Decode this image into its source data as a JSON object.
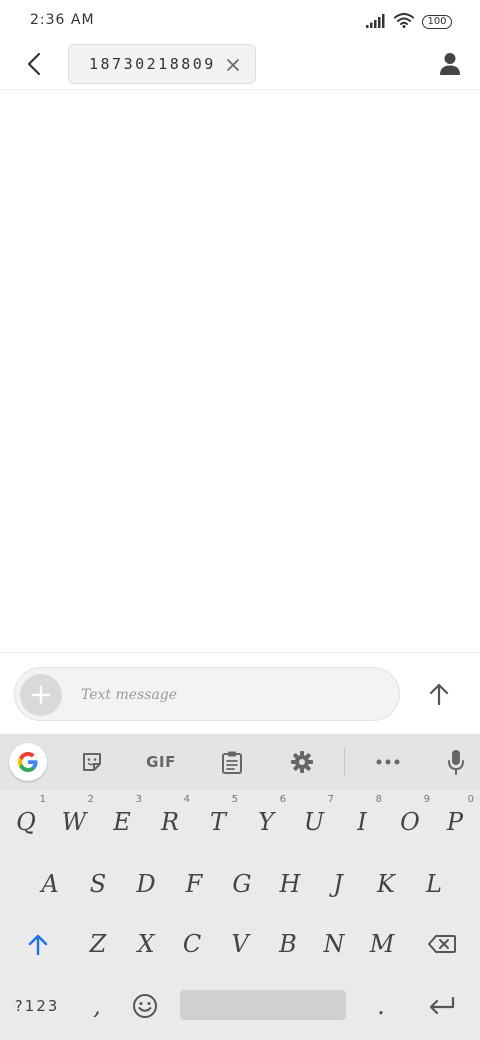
{
  "status_bar": {
    "time": "2:36 AM",
    "battery": "100",
    "icons": [
      "signal-icon",
      "wifi-icon",
      "battery-icon"
    ]
  },
  "header": {
    "back_icon": "back-arrow-icon",
    "recipient": "18730218809",
    "chip_close_icon": "close-icon",
    "contact_icon": "person-icon"
  },
  "compose": {
    "placeholder": "Text message",
    "value": "",
    "add_icon": "plus-icon",
    "send_icon": "arrow-up-icon"
  },
  "keyboard": {
    "toolbar": {
      "google": "google-icon",
      "sticker": "sticker-icon",
      "gif_label": "GIF",
      "clipboard": "clipboard-icon",
      "settings": "gear-icon",
      "more": "more-icon",
      "mic": "mic-icon"
    },
    "row1": [
      {
        "key": "Q",
        "hint": "1"
      },
      {
        "key": "W",
        "hint": "2"
      },
      {
        "key": "E",
        "hint": "3"
      },
      {
        "key": "R",
        "hint": "4"
      },
      {
        "key": "T",
        "hint": "5"
      },
      {
        "key": "Y",
        "hint": "6"
      },
      {
        "key": "U",
        "hint": "7"
      },
      {
        "key": "I",
        "hint": "8"
      },
      {
        "key": "O",
        "hint": "9"
      },
      {
        "key": "P",
        "hint": "0"
      }
    ],
    "row2": [
      "A",
      "S",
      "D",
      "F",
      "G",
      "H",
      "J",
      "K",
      "L"
    ],
    "row3": [
      "Z",
      "X",
      "C",
      "V",
      "B",
      "N",
      "M"
    ],
    "row4": {
      "symbols": "?123",
      "comma": ",",
      "period": "."
    },
    "colors": {
      "accent": "#1a73e8",
      "keyboard_bg": "#eaeaea"
    }
  }
}
